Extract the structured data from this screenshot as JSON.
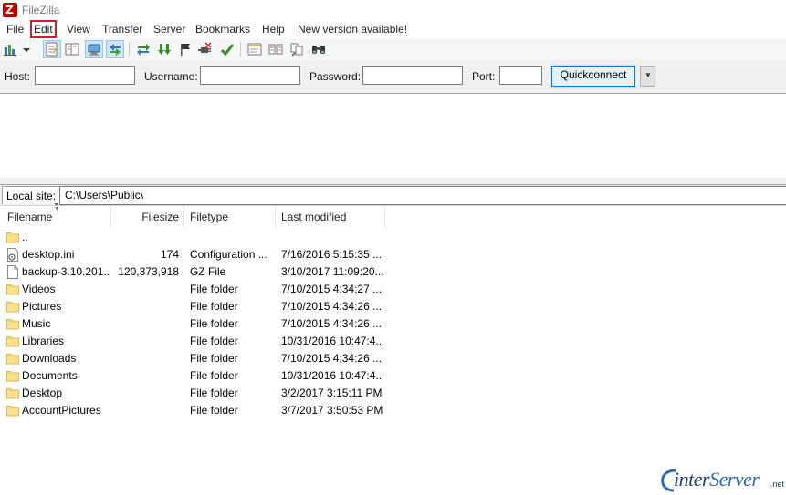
{
  "window": {
    "title": "FileZilla"
  },
  "menu": [
    "File",
    "Edit",
    "View",
    "Transfer",
    "Server",
    "Bookmarks",
    "Help",
    "New version available!"
  ],
  "toolbar": {
    "icons": [
      "site-manager-icon",
      "site-manager-dropdown-icon",
      "message-log-toggle-icon",
      "directory-tree-toggle-icon",
      "local-tree-toggle-icon",
      "remote-tree-toggle-icon",
      "refresh-icon",
      "process-queue-icon",
      "cancel-operation-icon",
      "disconnect-icon",
      "reconnect-icon",
      "directory-listing-filters-icon",
      "toggle-directory-comparison-icon",
      "synchronized-browsing-icon",
      "search-remote-files-icon"
    ]
  },
  "quickconnect": {
    "host_label": "Host:",
    "host_value": "",
    "username_label": "Username:",
    "username_value": "",
    "password_label": "Password:",
    "password_value": "",
    "port_label": "Port:",
    "port_value": "",
    "button_label": "Quickconnect",
    "dropdown_glyph": "▼"
  },
  "local_site": {
    "label": "Local site:",
    "path": "C:\\Users\\Public\\"
  },
  "file_list": {
    "columns": [
      "Filename",
      "Filesize",
      "Filetype",
      "Last modified"
    ],
    "rows": [
      {
        "icon": "folder",
        "name": "..",
        "size": "",
        "type": "",
        "modified": ""
      },
      {
        "icon": "ini",
        "name": "desktop.ini",
        "size": "174",
        "type": "Configuration ...",
        "modified": "7/16/2016 5:15:35 ..."
      },
      {
        "icon": "file",
        "name": "backup-3.10.201...",
        "size": "120,373,918",
        "type": "GZ File",
        "modified": "3/10/2017 11:09:20..."
      },
      {
        "icon": "folder",
        "name": "Videos",
        "size": "",
        "type": "File folder",
        "modified": "7/10/2015 4:34:27 ..."
      },
      {
        "icon": "folder",
        "name": "Pictures",
        "size": "",
        "type": "File folder",
        "modified": "7/10/2015 4:34:26 ..."
      },
      {
        "icon": "folder",
        "name": "Music",
        "size": "",
        "type": "File folder",
        "modified": "7/10/2015 4:34:26 ..."
      },
      {
        "icon": "folder",
        "name": "Libraries",
        "size": "",
        "type": "File folder",
        "modified": "10/31/2016 10:47:4..."
      },
      {
        "icon": "folder",
        "name": "Downloads",
        "size": "",
        "type": "File folder",
        "modified": "7/10/2015 4:34:26 ..."
      },
      {
        "icon": "folder",
        "name": "Documents",
        "size": "",
        "type": "File folder",
        "modified": "10/31/2016 10:47:4..."
      },
      {
        "icon": "folder",
        "name": "Desktop",
        "size": "",
        "type": "File folder",
        "modified": "3/2/2017 3:15:11 PM"
      },
      {
        "icon": "folder",
        "name": "AccountPictures",
        "size": "",
        "type": "File folder",
        "modified": "3/7/2017 3:50:53 PM"
      }
    ]
  },
  "watermark": {
    "brand_a": "inter",
    "brand_b": "Server",
    "suffix": ".net"
  },
  "colors": {
    "highlight_box": "#d31c24",
    "quickconnect_border": "#0078d7",
    "folder": "#f8d775",
    "brand": "#1b3d78"
  }
}
